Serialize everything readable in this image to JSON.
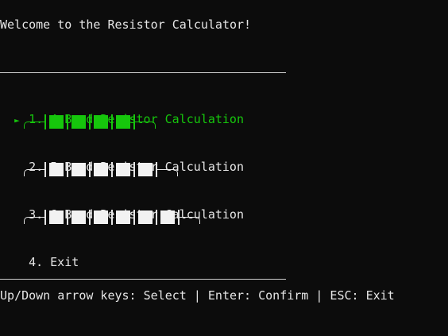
{
  "title": "Welcome to the Resistor Calculator!",
  "menu": {
    "pointer_glyph": "►",
    "items": [
      {
        "label": "1. 4 Band Resistor Calculation",
        "bands": 4,
        "selected": true
      },
      {
        "label": "2. 5 Band Resistor Calculation",
        "bands": 5,
        "selected": false
      },
      {
        "label": "3. 6 Band Resistor Calculation",
        "bands": 6,
        "selected": false
      },
      {
        "label": "4. Exit",
        "selected": false
      }
    ]
  },
  "footer": "Up/Down arrow keys: Select | Enter: Confirm | ESC: Exit",
  "colors": {
    "background": "#0c0c0c",
    "text": "#e6e6e6",
    "selected": "#16c60c"
  }
}
